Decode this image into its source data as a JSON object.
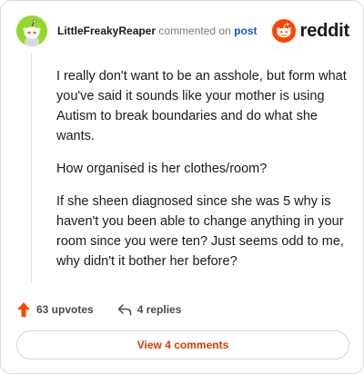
{
  "header": {
    "username": "LittleFreakyReaper",
    "action_text": "commented on",
    "link_text": "post",
    "brand": "reddit"
  },
  "comment": {
    "paragraphs": [
      "I really don't want to be an asshole, but form what you've said it sounds like your mother is using Autism to break boundaries and do what she wants.",
      "How organised is her clothes/room?",
      "If she sheen diagnosed since she was 5 why is haven't you been able to change anything in your room since you were ten? Just seems odd to me, why didn't it bother her before?"
    ]
  },
  "actions": {
    "upvotes": "63 upvotes",
    "replies": "4 replies"
  },
  "footer": {
    "view_comments": "View 4 comments"
  },
  "colors": {
    "avatar_bg": "#94d82d",
    "brand_orange": "#ff4500",
    "link_blue": "#0f5bbf",
    "upvote_orange": "#ff4500",
    "button_text": "#d93a00"
  },
  "icons": {
    "avatar": "snoo-avatar-icon",
    "logo": "reddit-snoo-icon",
    "upvote": "upvote-arrow-icon",
    "reply": "reply-arrow-icon"
  }
}
